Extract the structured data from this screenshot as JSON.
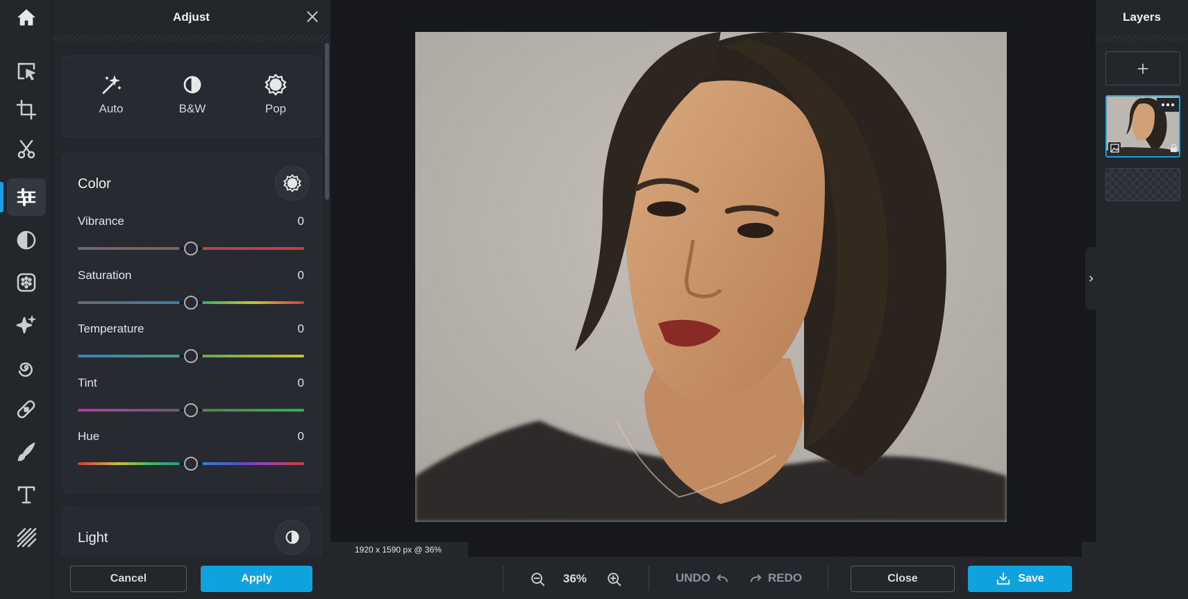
{
  "rail": {
    "tools": [
      "home-icon",
      "select-icon",
      "crop-icon",
      "cutout-icon",
      "adjust-icon",
      "filter-icon",
      "effects-icon",
      "magic-icon",
      "swirl-icon",
      "healing-icon",
      "brush-icon",
      "text-icon",
      "texture-icon"
    ],
    "active_tool": "adjust-icon",
    "accent": "#1a9ee0"
  },
  "panel": {
    "title": "Adjust",
    "quick": [
      {
        "label": "Auto",
        "icon": "magic-wand-icon"
      },
      {
        "label": "B&W",
        "icon": "contrast-icon"
      },
      {
        "label": "Pop",
        "icon": "sun-icon"
      }
    ],
    "color": {
      "title": "Color",
      "sliders": [
        {
          "label": "Vibrance",
          "value": "0"
        },
        {
          "label": "Saturation",
          "value": "0"
        },
        {
          "label": "Temperature",
          "value": "0"
        },
        {
          "label": "Tint",
          "value": "0"
        },
        {
          "label": "Hue",
          "value": "0"
        }
      ]
    },
    "light": {
      "title": "Light"
    },
    "cancel_label": "Cancel",
    "apply_label": "Apply"
  },
  "canvas": {
    "status": "1920 x 1590 px @ 36%"
  },
  "layers": {
    "title": "Layers"
  },
  "toolbar": {
    "zoom": "36%",
    "undo_label": "UNDO",
    "redo_label": "REDO",
    "close_label": "Close",
    "save_label": "Save"
  }
}
